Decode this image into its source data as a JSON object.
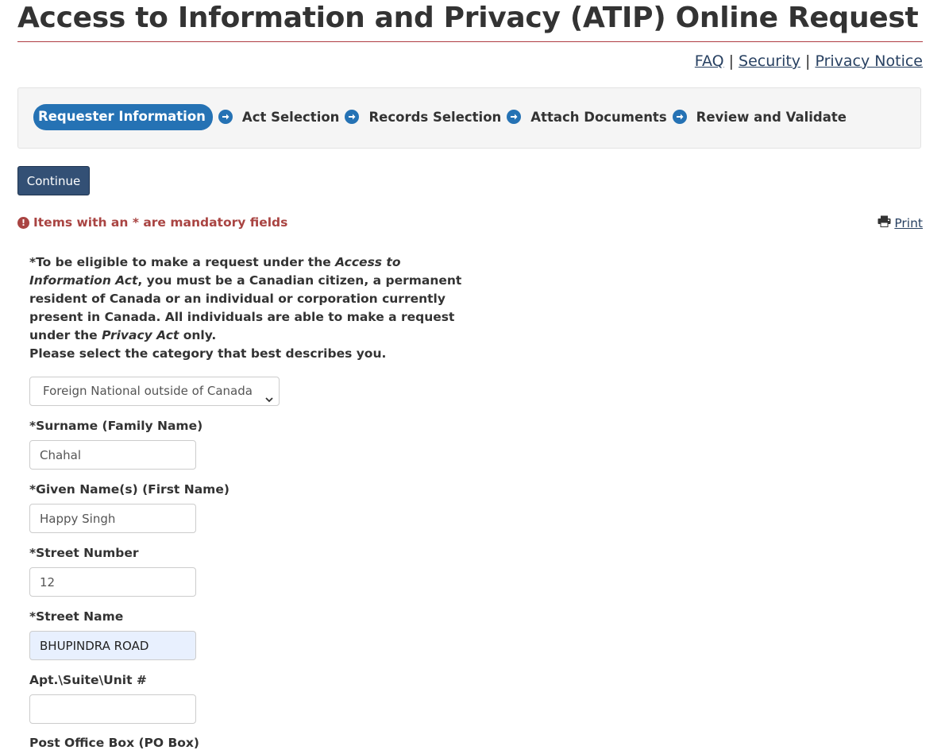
{
  "header": {
    "title": "Access to Information and Privacy (ATIP) Online Request",
    "links": {
      "faq": "FAQ",
      "security": "Security",
      "privacy": "Privacy Notice",
      "separator": "|"
    }
  },
  "steps": [
    {
      "label": "Requester Information",
      "active": true
    },
    {
      "label": "Act Selection",
      "active": false
    },
    {
      "label": "Records Selection",
      "active": false
    },
    {
      "label": "Attach Documents",
      "active": false
    },
    {
      "label": "Review and Validate",
      "active": false
    }
  ],
  "actions": {
    "continue_label": "Continue",
    "print_label": "Print"
  },
  "notice": {
    "mandatory": "Items with an * are mandatory fields",
    "eligibility_part1": "*To be eligible to make a request under the ",
    "eligibility_em1": "Access to Information Act",
    "eligibility_part2": ", you must be a Canadian citizen, a permanent resident of Canada or an individual or corporation currently present in Canada. All individuals are able to make a request under the ",
    "eligibility_em2": "Privacy Act",
    "eligibility_part3": " only.",
    "eligibility_prompt": "Please select the category that best describes you."
  },
  "form": {
    "category": {
      "selected": "Foreign National outside of Canada"
    },
    "surname": {
      "label": "*Surname (Family Name)",
      "value": "Chahal"
    },
    "given_names": {
      "label": "*Given Name(s) (First Name)",
      "value": "Happy Singh"
    },
    "street_number": {
      "label": "*Street Number",
      "value": "12"
    },
    "street_name": {
      "label": "*Street Name",
      "value": "BHUPINDRA ROAD"
    },
    "unit": {
      "label": "Apt.\\Suite\\Unit #",
      "value": ""
    },
    "po_box": {
      "label": "Post Office Box (PO Box)"
    }
  },
  "colors": {
    "accent": "#2572b4",
    "button": "#335075",
    "error": "#a94442",
    "rule": "#af3c43",
    "link": "#284162"
  },
  "icons": {
    "step_arrow": "circle-arrow-right-icon",
    "warning": "exclamation-circle-icon",
    "print": "printer-icon",
    "select": "chevron-down-icon"
  }
}
